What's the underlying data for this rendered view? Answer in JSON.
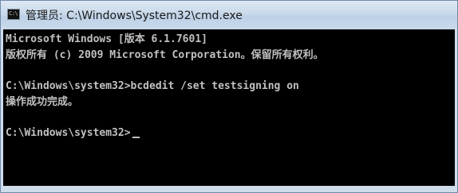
{
  "window": {
    "title": "管理员: C:\\Windows\\System32\\cmd.exe",
    "icon_label": "C:\\",
    "icon_name": "cmd-icon"
  },
  "console": {
    "lines": [
      "Microsoft Windows [版本 6.1.7601]",
      "版权所有 (c) 2009 Microsoft Corporation。保留所有权利。",
      "",
      "C:\\Windows\\system32>bcdedit /set testsigning on",
      "操作成功完成。",
      "",
      "C:\\Windows\\system32>"
    ]
  },
  "colors": {
    "console_bg": "#000000",
    "console_fg": "#c0c0c0"
  }
}
